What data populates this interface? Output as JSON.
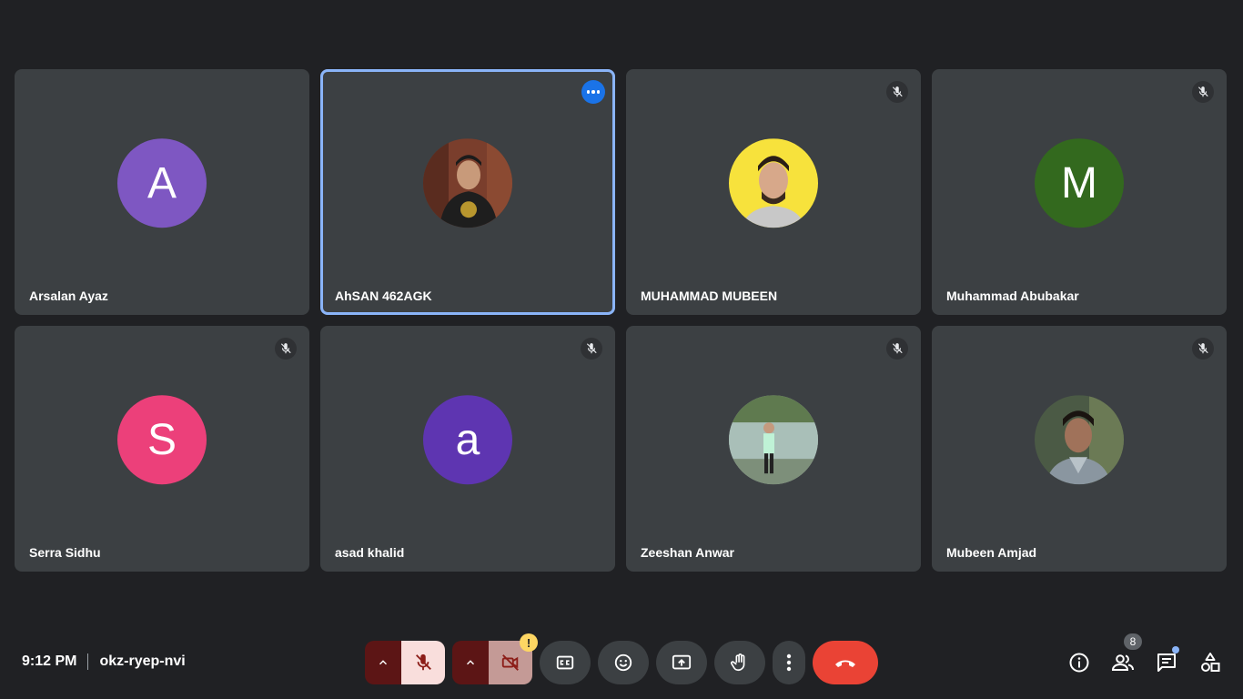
{
  "participants": [
    {
      "name": "Arsalan Ayaz",
      "initial": "A",
      "avatar_color": "#7e57c2",
      "muted": false
    },
    {
      "name": "AhSAN 462AGK",
      "initial": "",
      "avatar_color": "#6d3b2a",
      "muted": false,
      "active_speaker": true
    },
    {
      "name": "MUHAMMAD MUBEEN",
      "initial": "",
      "avatar_color": "#f7e23c",
      "muted": true
    },
    {
      "name": "Muhammad Abubakar",
      "initial": "M",
      "avatar_color": "#33691e",
      "muted": true
    },
    {
      "name": "Serra Sidhu",
      "initial": "S",
      "avatar_color": "#ec407a",
      "muted": true
    },
    {
      "name": "asad khalid",
      "initial": "a",
      "avatar_color": "#5e35b1",
      "muted": true
    },
    {
      "name": "Zeeshan Anwar",
      "initial": "",
      "avatar_color": "#8fa39a",
      "muted": true
    },
    {
      "name": "Mubeen Amjad",
      "initial": "",
      "avatar_color": "#3b4a3f",
      "muted": true
    }
  ],
  "meeting": {
    "time": "9:12 PM",
    "code": "okz-ryep-nvi"
  },
  "controls": {
    "mic": {
      "icon": "mic-off-icon",
      "state": "off"
    },
    "camera": {
      "icon": "videocam-off-icon",
      "state": "off",
      "warning": "!"
    },
    "captions": {
      "icon": "captions-icon"
    },
    "reactions": {
      "icon": "emoji-icon"
    },
    "present": {
      "icon": "present-screen-icon"
    },
    "raise_hand": {
      "icon": "raise-hand-icon"
    },
    "more": {
      "icon": "more-vert-icon"
    },
    "leave": {
      "icon": "call-end-icon"
    }
  },
  "side_controls": {
    "people_count": "8",
    "icons": [
      "info-icon",
      "people-icon",
      "chat-icon",
      "activities-icon"
    ]
  },
  "colors": {
    "background": "#202124",
    "tile": "#3c4043",
    "accent": "#8ab4f8",
    "danger": "#ea4335"
  }
}
